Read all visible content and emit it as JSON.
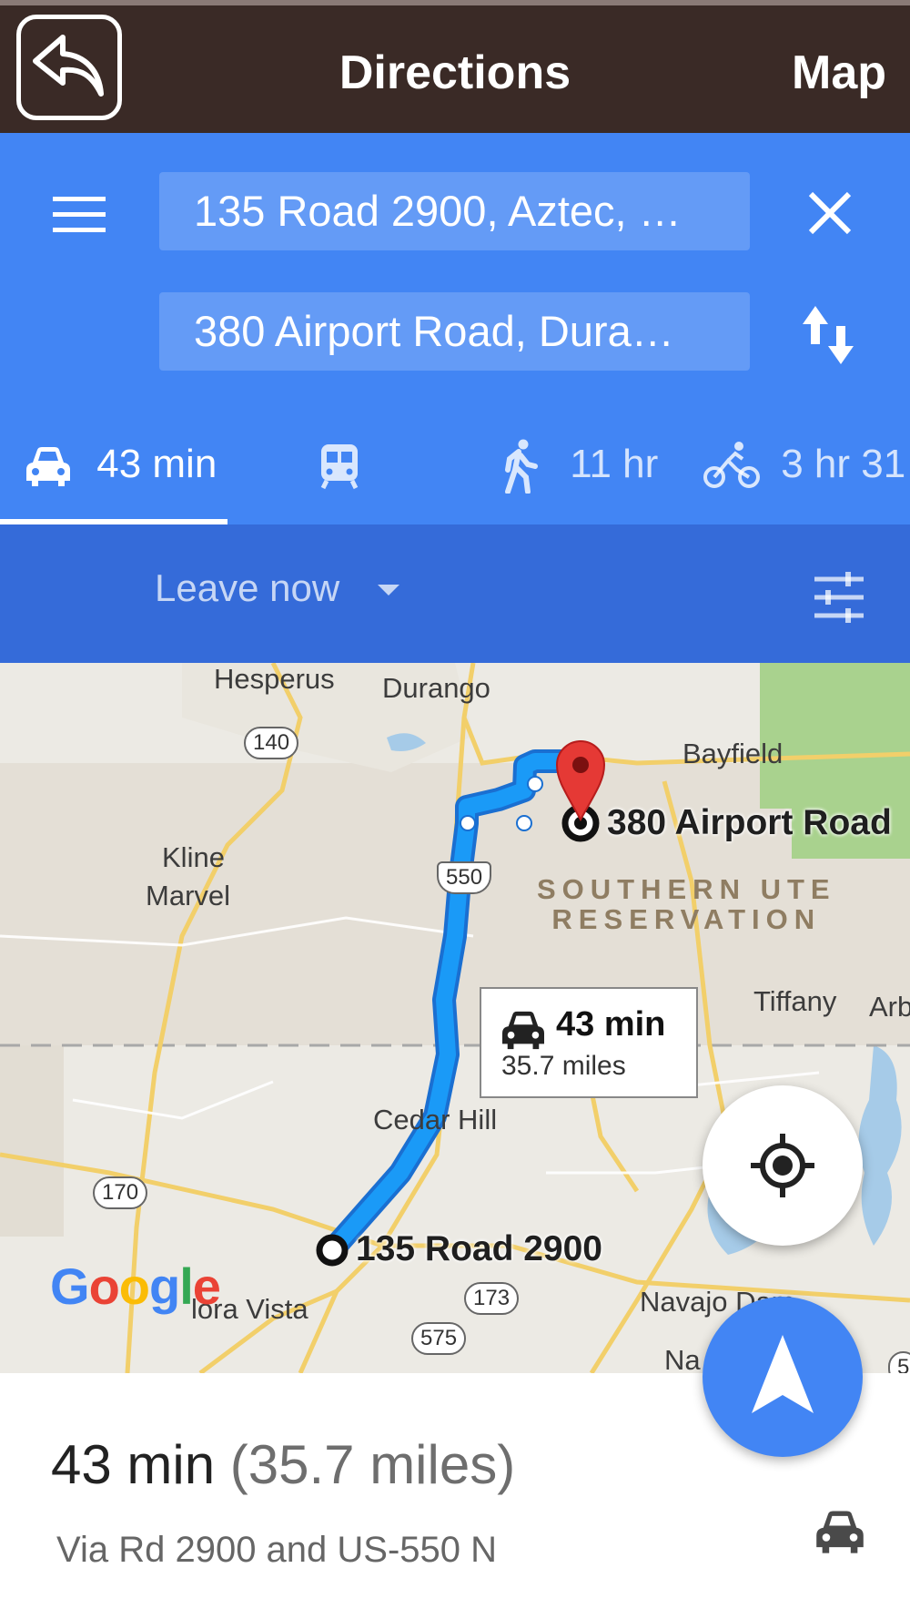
{
  "topbar": {
    "title": "Directions",
    "map_label": "Map",
    "back_icon": "back-arrow-icon"
  },
  "search": {
    "origin": "135 Road 2900, Aztec, …",
    "destination": "380 Airport Road, Dura…",
    "menu_icon": "menu-icon",
    "close_icon": "close-icon",
    "swap_icon": "swap-icon"
  },
  "modes": [
    {
      "icon": "car-icon",
      "label": "43 min",
      "selected": true
    },
    {
      "icon": "transit-icon",
      "label": ""
    },
    {
      "icon": "walk-icon",
      "label": "11 hr"
    },
    {
      "icon": "bike-icon",
      "label": "3 hr 31"
    }
  ],
  "options": {
    "leave_label": "Leave now",
    "filter_icon": "tune-icon"
  },
  "map": {
    "places": {
      "hesperus": "Hesperus",
      "durango": "Durango",
      "bayfield": "Bayfield",
      "kline": "Kline",
      "marvel": "Marvel",
      "tiffany": "Tiffany",
      "arb": "Arb",
      "cedar_hill": "Cedar Hill",
      "flora_vista": "lora Vista",
      "navajo_dam": "Navajo Dam",
      "na": "Na"
    },
    "reservation": [
      "SOUTHERN UTE",
      "RESERVATION"
    ],
    "shields": {
      "s140": "140",
      "s550": "550",
      "s170": "170",
      "s173": "173",
      "s575": "575",
      "s5": "5"
    },
    "destination_label": "380 Airport Road",
    "origin_label": "135 Road 2900",
    "info": {
      "time": "43 min",
      "distance": "35.7 miles"
    },
    "attribution": "Google"
  },
  "summary": {
    "time": "43 min",
    "distance": "(35.7 miles)",
    "via": "Via Rd 2900 and US-550 N"
  },
  "colors": {
    "header": "#3a2a26",
    "panel": "#4285f4",
    "options": "#356bd9",
    "route": "#1a9af7"
  }
}
